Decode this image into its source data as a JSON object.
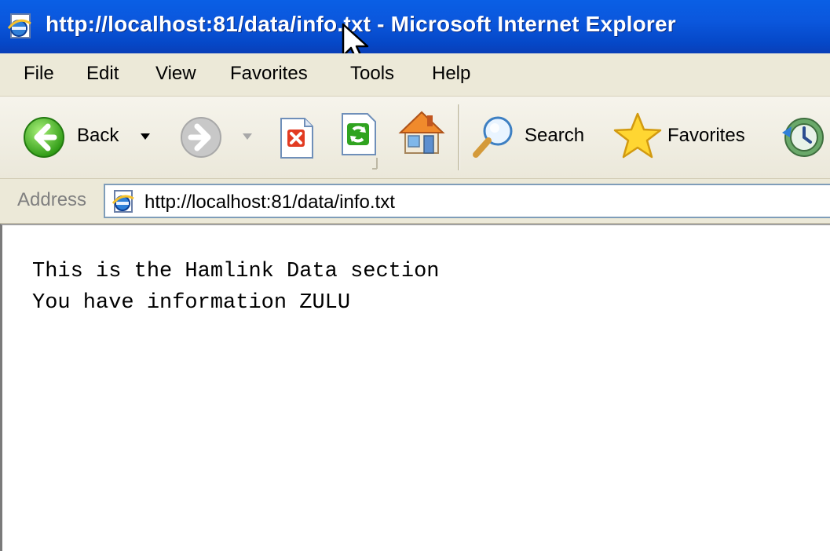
{
  "window": {
    "title": "http://localhost:81/data/info.txt - Microsoft Internet Explorer"
  },
  "menu": [
    "File",
    "Edit",
    "View",
    "Favorites",
    "Tools",
    "Help"
  ],
  "toolbar": {
    "back_label": "Back",
    "search_label": "Search",
    "favorites_label": "Favorites"
  },
  "address": {
    "label": "Address",
    "value": "http://localhost:81/data/info.txt"
  },
  "document": {
    "lines": [
      "This is the Hamlink Data section",
      "You have information ZULU"
    ]
  }
}
